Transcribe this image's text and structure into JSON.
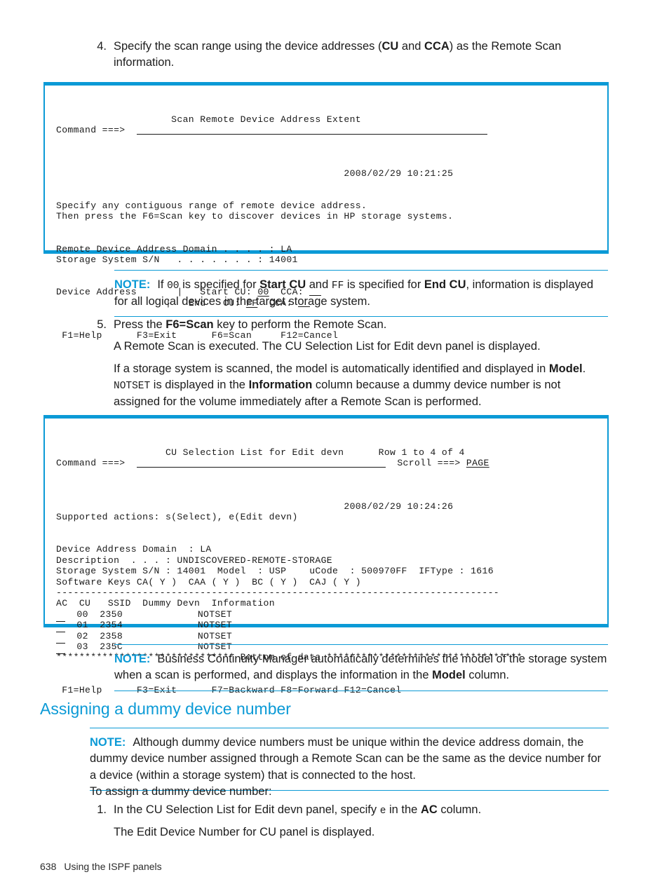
{
  "step4": {
    "number": "4.",
    "text_parts": [
      {
        "t": "Specify the scan range using the device addresses ("
      },
      {
        "t": "CU",
        "bold": true
      },
      {
        "t": " and "
      },
      {
        "t": "CCA",
        "bold": true
      },
      {
        "t": ") as the Remote Scan information."
      }
    ],
    "plain": "Specify the scan range using the device addresses (CU and CCA) as the Remote Scan information."
  },
  "panel1": {
    "name": "scan-remote-device-address-extent-panel",
    "title": "Scan Remote Device Address Extent",
    "command_label": "Command ===>",
    "command_value": "",
    "timestamp": "2008/02/29 10:21:25",
    "instruction_line1": "Specify any contiguous range of remote device address.",
    "instruction_line2": "Then press the F6=Scan key to discover devices in HP storage systems.",
    "domain_label": "Remote Device Address Domain . . . . :",
    "domain_value": "LA",
    "serial_label": "Storage System S/N   . . . . . . . :",
    "serial_value": "14001",
    "device_address_label": "Device Address",
    "start_label": "Start",
    "start_cu_label": "CU:",
    "start_cu_value": "00",
    "start_cca_label": "CCA:",
    "start_cca_value": "",
    "end_label": "End",
    "end_cu_label": "CU:",
    "end_cu_value": "FF",
    "end_cca_label": "CCA:",
    "end_cca_value": "",
    "fkeys": [
      "F1=Help",
      "F3=Exit",
      "F6=Scan",
      "F12=Cancel"
    ]
  },
  "note1": {
    "label": "NOTE:",
    "parts": [
      {
        "t": "If "
      },
      {
        "t": "00",
        "mono": true
      },
      {
        "t": " is specified for "
      },
      {
        "t": "Start CU",
        "bold": true
      },
      {
        "t": " and "
      },
      {
        "t": "FF",
        "mono": true
      },
      {
        "t": " is specified for "
      },
      {
        "t": "End CU",
        "bold": true
      },
      {
        "t": ", information is displayed for all logical devices in the target storage system."
      }
    ]
  },
  "step5": {
    "number": "5.",
    "line1_parts": [
      {
        "t": "Press the "
      },
      {
        "t": "F6=Scan",
        "bold": true
      },
      {
        "t": " key to perform the Remote Scan."
      }
    ],
    "line2": "A Remote Scan is executed. The CU Selection List for Edit devn panel is displayed.",
    "line3_parts": [
      {
        "t": "If a storage system is scanned, the model is automatically identified and displayed in "
      },
      {
        "t": "Model",
        "bold": true
      },
      {
        "t": ". "
      },
      {
        "t": "NOTSET",
        "mono": true
      },
      {
        "t": " is displayed in the "
      },
      {
        "t": "Information",
        "bold": true
      },
      {
        "t": " column because a dummy device number is not assigned for the volume immediately after a Remote Scan is performed."
      }
    ]
  },
  "panel2": {
    "name": "cu-selection-list-for-edit-devn-panel",
    "title": "CU Selection List for Edit devn",
    "row_range": "Row 1 to 4 of 4",
    "command_label": "Command ===>",
    "command_value": "",
    "scroll_label": "Scroll ===>",
    "scroll_value": "PAGE",
    "timestamp": "2008/02/29 10:24:26",
    "supported_actions": "Supported actions: s(Select), e(Edit devn)",
    "domain_label": "Device Address Domain  :",
    "domain_value": "LA",
    "description_label": "Description  . . . :",
    "description_value": "UNDISCOVERED-REMOTE-STORAGE",
    "serial_label": "Storage System S/N :",
    "serial_value": "14001",
    "model_label": "Model  :",
    "model_value": "USP",
    "ucode_label": "uCode  :",
    "ucode_value": "500970FF",
    "iftype_label": "IFType :",
    "iftype_value": "1616",
    "software_keys_label": "Software Keys",
    "software_keys": "CA( Y )  CAA ( Y )  BC ( Y )  CAJ ( Y )",
    "separator": "-----------------------------------------------------------------------------",
    "columns": [
      "AC",
      "CU",
      "SSID",
      "Dummy Devn",
      "Information"
    ],
    "rows": [
      {
        "ac": "",
        "cu": "00",
        "ssid": "2350",
        "dummy_devn": "",
        "information": "NOTSET"
      },
      {
        "ac": "",
        "cu": "01",
        "ssid": "2354",
        "dummy_devn": "",
        "information": "NOTSET"
      },
      {
        "ac": "",
        "cu": "02",
        "ssid": "2358",
        "dummy_devn": "",
        "information": "NOTSET"
      },
      {
        "ac": "",
        "cu": "03",
        "ssid": "235C",
        "dummy_devn": "",
        "information": "NOTSET"
      }
    ],
    "bottom_of_data": "******************************* Bottom of data **********************************",
    "fkeys": [
      "F1=Help",
      "F3=Exit",
      "F7=Backward",
      "F8=Forward",
      "F12=Cancel"
    ]
  },
  "note2": {
    "label": "NOTE:",
    "parts": [
      {
        "t": "Business Continuity Manager automatically determines the model of the storage system when a scan is performed, and displays the information in the "
      },
      {
        "t": "Model",
        "bold": true
      },
      {
        "t": " column."
      }
    ]
  },
  "heading": {
    "text": "Assigning a dummy device number"
  },
  "note3": {
    "label": "NOTE:",
    "parts": [
      {
        "t": "Although dummy device numbers must be unique within the device address domain, the dummy device number assigned through a Remote Scan can be the same as the device number for a device (within a storage system) that is connected to the host."
      }
    ]
  },
  "closing": {
    "intro": "To assign a dummy device number:",
    "step1_number": "1.",
    "step1_parts": [
      {
        "t": "In the CU Selection List for Edit devn panel, specify "
      },
      {
        "t": "e",
        "mono": true
      },
      {
        "t": " in the "
      },
      {
        "t": "AC",
        "bold": true
      },
      {
        "t": " column."
      }
    ],
    "step1_followup": "The Edit Device Number for CU panel is displayed."
  },
  "footer": {
    "page_number": "638",
    "section": "Using the ISPF panels"
  },
  "colors": {
    "accent": "#0b9ad6",
    "text": "#1c1c1c"
  }
}
